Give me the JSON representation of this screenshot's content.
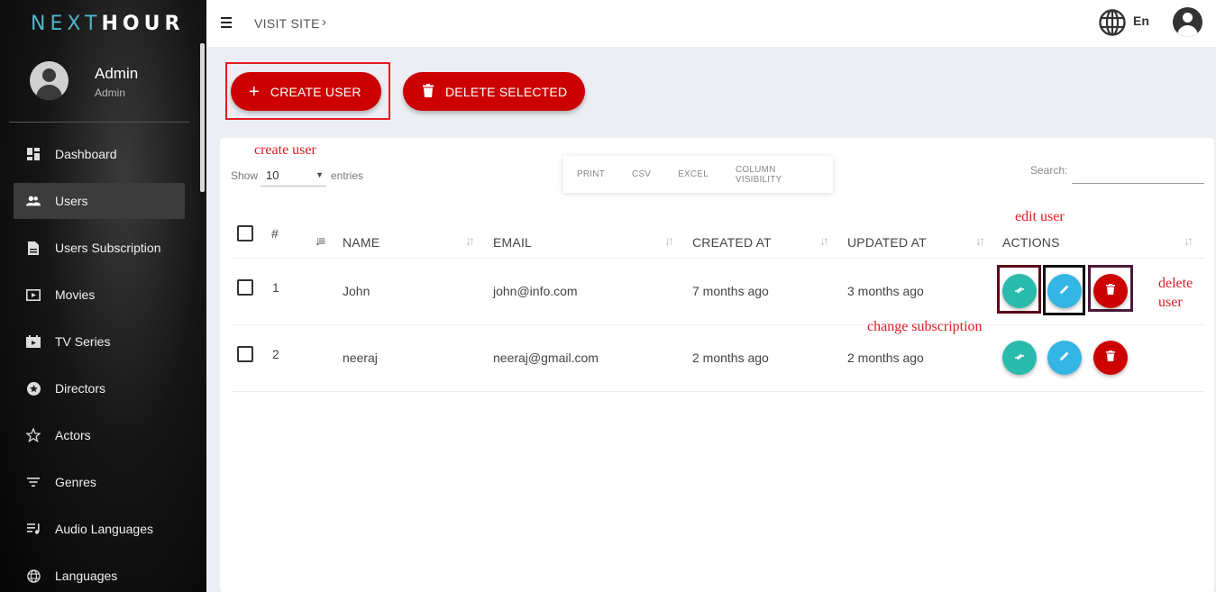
{
  "brand": {
    "logo_part1": "NEXT",
    "logo_part2": "HOUR",
    "accent": "#4fb4c7"
  },
  "user": {
    "name": "Admin",
    "role": "Admin"
  },
  "sidebar": {
    "items": [
      {
        "label": "Dashboard",
        "icon": "dashboard-icon"
      },
      {
        "label": "Users",
        "icon": "users-icon",
        "active": true
      },
      {
        "label": "Users Subscription",
        "icon": "document-icon"
      },
      {
        "label": "Movies",
        "icon": "movie-icon"
      },
      {
        "label": "TV Series",
        "icon": "tv-icon"
      },
      {
        "label": "Directors",
        "icon": "star-circle-icon"
      },
      {
        "label": "Actors",
        "icon": "star-icon"
      },
      {
        "label": "Genres",
        "icon": "filter-icon"
      },
      {
        "label": "Audio Languages",
        "icon": "playlist-icon"
      },
      {
        "label": "Languages",
        "icon": "globe-icon"
      }
    ]
  },
  "topbar": {
    "visit_site": "VISIT SITE",
    "chevron": "›",
    "language": "En"
  },
  "actions": {
    "create_user": "CREATE USER",
    "delete_selected": "DELETE SELECTED",
    "brand_red": "#cc0000"
  },
  "annotations": {
    "create_user": "create user",
    "edit_user": "edit user",
    "delete_user_line1": "delete",
    "delete_user_line2": "user",
    "change_subscription": "change subscription",
    "color": "#e31b23"
  },
  "table_controls": {
    "show_label": "Show",
    "entries_value": "10",
    "entries_label": "entries",
    "export_buttons": [
      "PRINT",
      "CSV",
      "EXCEL",
      "COLUMN VISIBILITY"
    ],
    "search_label": "Search:",
    "search_value": ""
  },
  "table": {
    "headers": {
      "num": "#",
      "name": "NAME",
      "email": "EMAIL",
      "created": "CREATED AT",
      "updated": "UPDATED AT",
      "actions": "ACTIONS"
    },
    "rows": [
      {
        "num": "1",
        "name": "John",
        "email": "john@info.com",
        "created": "7 months ago",
        "updated": "3 months ago"
      },
      {
        "num": "2",
        "name": "neeraj",
        "email": "neeraj@gmail.com",
        "created": "2 months ago",
        "updated": "2 months ago"
      }
    ]
  }
}
